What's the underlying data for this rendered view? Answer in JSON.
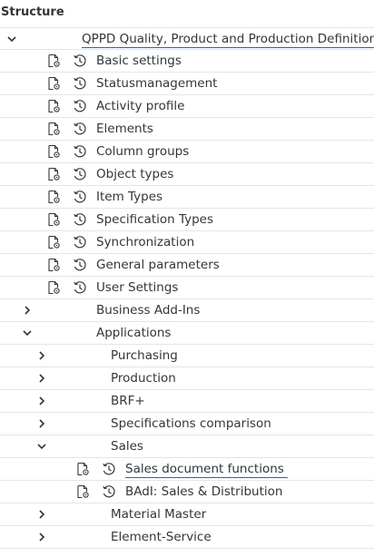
{
  "header": {
    "title": "Structure"
  },
  "tree": {
    "root_label": "QPPD Quality, Product and Production Definition",
    "level1_items": [
      "Basic settings",
      "Statusmanagement",
      "Activity profile",
      "Elements",
      "Column groups",
      "Object types",
      "Item Types",
      "Specification Types",
      "Synchronization",
      "General parameters",
      "User Settings"
    ],
    "business_addins_label": "Business Add-Ins",
    "applications_label": "Applications",
    "applications_children": {
      "purchasing": "Purchasing",
      "production": "Production",
      "brf": "BRF+",
      "spec_comparison": "Specifications comparison",
      "sales": "Sales",
      "sales_children": [
        "Sales document functions",
        "BAdI: Sales & Distribution"
      ],
      "material_master": "Material Master",
      "element_service": "Element-Service"
    }
  },
  "colors": {
    "selection_underline": "#0a6ed1",
    "icon": "#32363a",
    "divider": "#e5e5e5"
  },
  "icons": {
    "doc": "document-settings-icon",
    "clock": "history-clock-icon",
    "expand": "chevron-right-icon",
    "collapse": "chevron-down-icon"
  }
}
